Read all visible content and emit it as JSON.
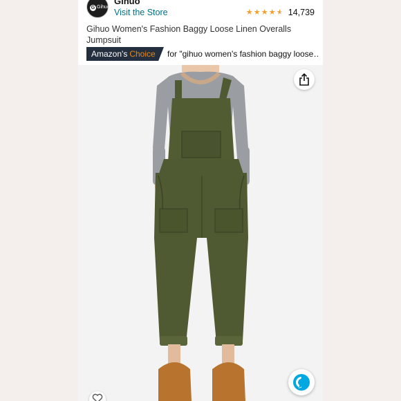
{
  "brand": {
    "name": "Gihuo",
    "logo_text": "Gihuo",
    "logo_mark": "G",
    "visit_store_label": "Visit the Store"
  },
  "rating": {
    "stars": 4.5,
    "review_count": "14,739"
  },
  "product": {
    "title": "Gihuo Women's Fashion Baggy Loose Linen Overalls Jumpsuit"
  },
  "badge": {
    "prefix": "Amazon's",
    "choice_word": "Choice",
    "for_text": "for \"gihuo women's fashion baggy loose…"
  },
  "icons": {
    "share": "share-icon",
    "alexa": "alexa-icon",
    "wishlist": "heart-icon",
    "star": "star-icon"
  },
  "colors": {
    "link": "#007185",
    "badge_bg": "#232f3e",
    "badge_accent": "#f08804",
    "star": "#f1a02e",
    "alexa": "#00a8e1",
    "garment": "#4f5a32"
  }
}
